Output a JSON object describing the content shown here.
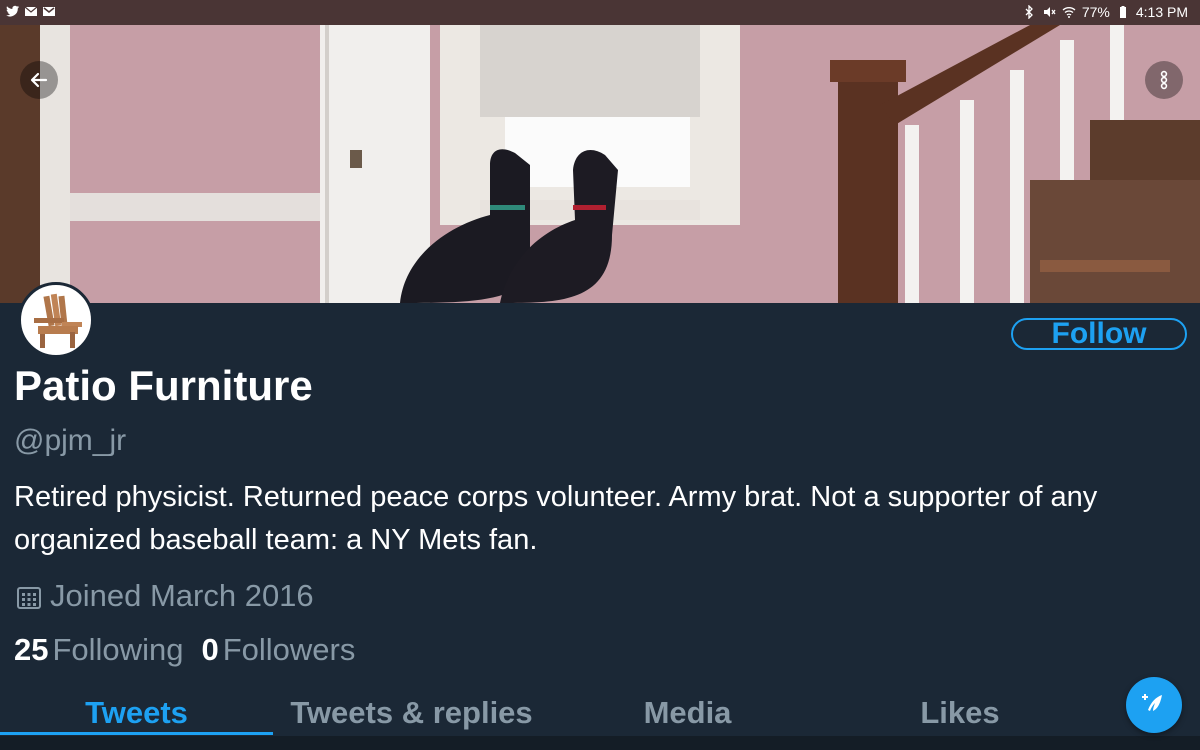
{
  "status_bar": {
    "battery": "77%",
    "time": "4:13 PM",
    "left_icons": [
      "twitter-icon",
      "mail-icon",
      "gmail-icon"
    ],
    "right_icons": [
      "bluetooth-icon",
      "mute-icon",
      "wifi-icon",
      "battery-icon"
    ]
  },
  "profile": {
    "display_name": "Patio Furniture",
    "handle": "@pjm_jr",
    "bio": "Retired physicist. Returned peace corps volunteer. Army brat. Not a supporter of any organized baseball team: a NY Mets fan.",
    "joined": "Joined March 2016",
    "following_count": "25",
    "following_label": "Following",
    "followers_count": "0",
    "followers_label": "Followers",
    "follow_button": "Follow"
  },
  "tabs": [
    {
      "label": "Tweets",
      "active": true
    },
    {
      "label": "Tweets & replies",
      "active": false
    },
    {
      "label": "Media",
      "active": false
    },
    {
      "label": "Likes",
      "active": false
    }
  ],
  "colors": {
    "background": "#1b2836",
    "accent": "#1da1f2",
    "secondary_text": "#8899a6",
    "status_bar": "#4a3535"
  },
  "icons": {
    "back": "arrow-left-icon",
    "more": "more-vertical-icon",
    "calendar": "calendar-icon",
    "compose": "compose-tweet-icon"
  }
}
